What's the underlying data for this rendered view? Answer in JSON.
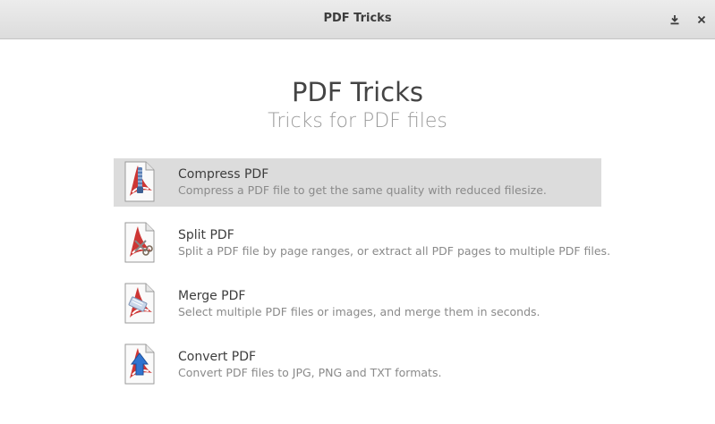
{
  "window": {
    "title": "PDF Tricks",
    "download_icon": "download-icon",
    "close_icon": "close-icon"
  },
  "header": {
    "title": "PDF Tricks",
    "subtitle": "Tricks for PDF files"
  },
  "tools": [
    {
      "name": "Compress PDF",
      "description": "Compress a PDF file to get the same quality with reduced filesize.",
      "icon": "pdf-compress-icon",
      "selected": true
    },
    {
      "name": "Split PDF",
      "description": "Split a PDF file by page ranges, or extract all PDF pages to multiple PDF files.",
      "icon": "pdf-split-icon",
      "selected": false
    },
    {
      "name": "Merge PDF",
      "description": "Select multiple PDF files or images, and merge them in seconds.",
      "icon": "pdf-merge-icon",
      "selected": false
    },
    {
      "name": "Convert PDF",
      "description": "Convert PDF files to JPG, PNG and TXT formats.",
      "icon": "pdf-convert-icon",
      "selected": false
    }
  ],
  "colors": {
    "selected_row": "#dcdcdc",
    "pdf_red": "#c8201e",
    "title_text": "#444444",
    "subtitle_text": "#9a9a9a"
  }
}
